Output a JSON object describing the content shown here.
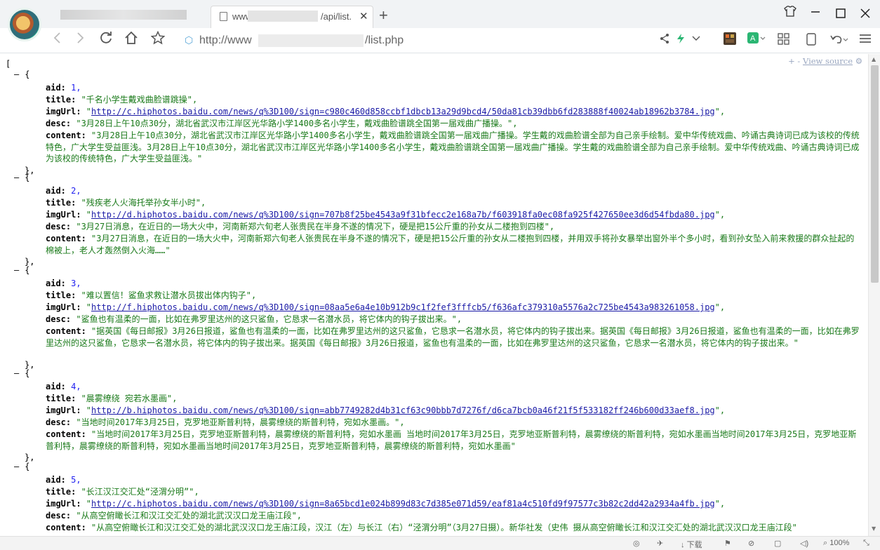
{
  "browser": {
    "tab_title_start": "www",
    "tab_title_end": "/api/list.",
    "tab_close": "✕",
    "new_tab": "+",
    "url_start": "http://www",
    "url_end": "/list.php",
    "window_controls": [
      "minimize",
      "maximize",
      "close"
    ]
  },
  "viewer": {
    "view_source": "View source",
    "expand_marks": "+ -",
    "open_bracket": "[",
    "collapse_toggle": "–",
    "object_open": "{",
    "object_close": "},"
  },
  "status": {
    "download": "下载",
    "zoom": "100%"
  },
  "items": [
    {
      "aid": "1,",
      "title": "\"千名小学生戴戏曲脸谱跳操\",",
      "imgUrl": "http://c.hiphotos.baidu.com/news/q%3D100/sign=c980c460d858ccbf1dbcb13a29d9bcd4/50da81cb39dbb6fd283888f40024ab18962b3784.jpg",
      "desc": "\"3月28日上午10点30分，湖北省武汉市江岸区光华路小学1400多名小学生，戴戏曲脸谱跳全国第一届戏曲广播操。\",",
      "content": "\"3月28日上午10点30分，湖北省武汉市江岸区光华路小学1400多名小学生，戴戏曲脸谱跳全国第一届戏曲广播操。学生戴的戏曲脸谱全部为自己亲手绘制。爱中华传统戏曲、吟诵古典诗词已成为该校的传统特色，广大学生受益匪浅。3月28日上午10点30分，湖北省武汉市江岸区光华路小学1400多名小学生，戴戏曲脸谱跳全国第一届戏曲广播操。学生戴的戏曲脸谱全部为自己亲手绘制。爱中华传统戏曲、吟诵古典诗词已成为该校的传统特色，广大学生受益匪浅。\""
    },
    {
      "aid": "2,",
      "title": "\"残疾老人火海托举孙女半小时\",",
      "imgUrl": "http://d.hiphotos.baidu.com/news/q%3D100/sign=707b8f25be4543a9f31bfecc2e168a7b/f603918fa0ec08fa925f427650ee3d6d54fbda80.jpg",
      "desc": "\"3月27日消息，在近日的一场大火中，河南新郑六旬老人张贵民在半身不遂的情况下，硬是把15公斤重的孙女从二楼抱到四楼\",",
      "content": "\"3月27日消息，在近日的一场大火中，河南新郑六旬老人张贵民在半身不遂的情况下，硬是把15公斤重的孙女从二楼抱到四楼，并用双手将孙女暴举出窗外半个多小时，看到孙女坠入前来救援的群众扯起的棉被上，老人才轰然倒入火海……\""
    },
    {
      "aid": "3,",
      "title": "\"难以置信！鲨鱼求救让潜水员拔出体内钩子\",",
      "imgUrl": "http://f.hiphotos.baidu.com/news/q%3D100/sign=08aa5e6a4e10b912b9c1f2fef3fffcb5/f636afc379310a5576a2c725be4543a983261058.jpg",
      "desc": "\"鲨鱼也有温柔的一面，比如在弗罗里达州的这只鲨鱼，它恳求一名潜水员，将它体内的钩子拔出来。\",",
      "content": "\"据英国《每日邮报》3月26日报道，鲨鱼也有温柔的一面，比如在弗罗里达州的这只鲨鱼，它恳求一名潜水员，将它体内的钩子拔出来。据英国《每日邮报》3月26日报道，鲨鱼也有温柔的一面，比如在弗罗里达州的这只鲨鱼，它恳求一名潜水员，将它体内的钩子拔出来。据英国《每日邮报》3月26日报道，鲨鱼也有温柔的一面，比如在弗罗里达州的这只鲨鱼，它恳求一名潜水员，将它体内的钩子拔出来。\""
    },
    {
      "aid": "4,",
      "title": "\"晨雾缭绕 宛若水墨画\",",
      "imgUrl": "http://b.hiphotos.baidu.com/news/q%3D100/sign=abb7749282d4b31cf63c90bbb7d7276f/d6ca7bcb0a46f21f5f533182ff246b600d33aef8.jpg",
      "desc": "\"当地时间2017年3月25日，克罗地亚斯普利特，晨雾缭绕的斯普利特，宛如水墨画。\",",
      "content": "\"当地时间2017年3月25日，克罗地亚斯普利特，晨雾缭绕的斯普利特，宛如水墨画 当地时间2017年3月25日，克罗地亚斯普利特，晨雾缭绕的斯普利特，宛如水墨画当地时间2017年3月25日，克罗地亚斯普利特，晨雾缭绕的斯普利特，宛如水墨画当地时间2017年3月25日，克罗地亚斯普利特，晨雾缭绕的斯普利特，宛如水墨画\""
    },
    {
      "aid": "5,",
      "title": "\"长江汉江交汇处“泾渭分明”\",",
      "imgUrl": "http://c.hiphotos.baidu.com/news/q%3D100/sign=8a65bcd1e024b899d83c7d385e071d59/eaf81a4c510fd9f97577c3b82c2dd42a2934a4fb.jpg",
      "desc": "\"从高空俯瞰长江和汉江交汇处的湖北武汉汉口龙王庙江段\",",
      "content": "\"从高空俯瞰长江和汉江交汇处的湖北武汉汉口龙王庙江段，汉江（左）与长江（右）“泾渭分明”（3月27日摄）。新华社发（史伟 摄从高空俯瞰长江和汉江交汇处的湖北武汉汉口龙王庙江段\""
    }
  ]
}
